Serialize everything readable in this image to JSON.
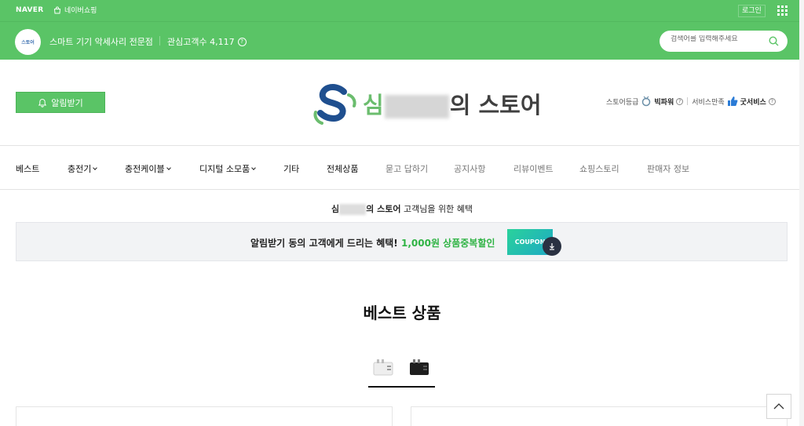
{
  "topbar": {
    "naver_logo": "NAVER",
    "shopping_label": "네이버쇼핑",
    "login_label": "로그인"
  },
  "store": {
    "avatar_text": "스토어",
    "description": "스마트 기기 악세사리 전문점",
    "interest_label": "관심고객수 4,117",
    "search_placeholder": "검색어를 입력해주세요"
  },
  "header": {
    "alarm_label": "알림받기",
    "logo_first": "심",
    "logo_rest": "의 스토어",
    "grade_label": "스토어등급",
    "grade_value": "빅파워",
    "service_label": "서비스만족",
    "service_value": "굿서비스"
  },
  "nav": {
    "items": [
      {
        "label": "베스트"
      },
      {
        "label": "충전기"
      },
      {
        "label": "충전케이블"
      },
      {
        "label": "디지털 소모품"
      },
      {
        "label": "기타"
      },
      {
        "label": "전체상품"
      },
      {
        "label": "묻고 답하기"
      },
      {
        "label": "공지사항"
      },
      {
        "label": "리뷰이벤트"
      },
      {
        "label": "쇼핑스토리"
      },
      {
        "label": "판매자 정보"
      }
    ]
  },
  "benefit": {
    "title_prefix": "심",
    "title_store": "의 스토어",
    "title_suffix": "고객님을 위한 혜택",
    "text_main": "알림받기 동의 고객에게 드리는 혜택!",
    "text_highlight": "1,000원 상품중복할인",
    "coupon_label": "COUPON"
  },
  "best": {
    "title": "베스트 상품"
  },
  "colors": {
    "brand_green": "#5ac466",
    "highlight_green": "#2fb344"
  }
}
